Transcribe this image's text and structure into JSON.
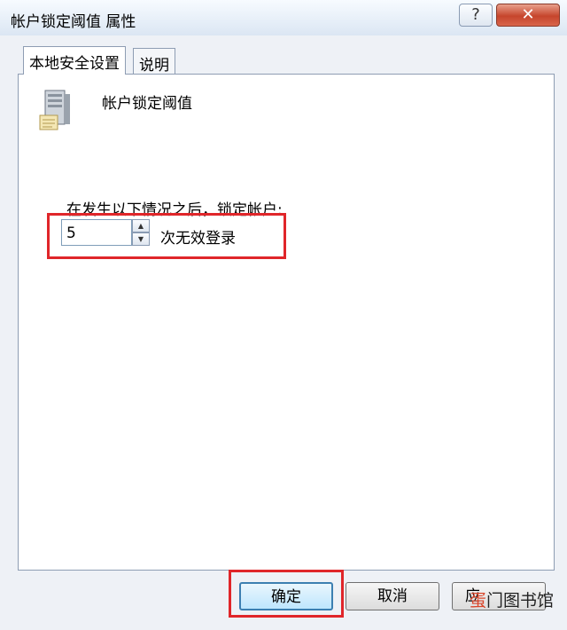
{
  "window": {
    "title": "帐户锁定阈值 属性"
  },
  "titlebar": {
    "help_symbol": "?",
    "close_symbol": "✕"
  },
  "tabs": [
    {
      "label": "本地安全设置",
      "active": true
    },
    {
      "label": "说明",
      "active": false
    }
  ],
  "policy": {
    "icon": "server-policy-icon",
    "title": "帐户锁定阈值"
  },
  "lockout": {
    "label": "在发生以下情况之后，锁定帐户:",
    "value": "5",
    "unit": "次无效登录"
  },
  "buttons": {
    "ok": "确定",
    "cancel": "取消",
    "apply": "应"
  },
  "watermark": {
    "accent": "蛋",
    "text": "门图书馆"
  },
  "colors": {
    "highlight": "#e0262a",
    "close": "#c6452c"
  }
}
